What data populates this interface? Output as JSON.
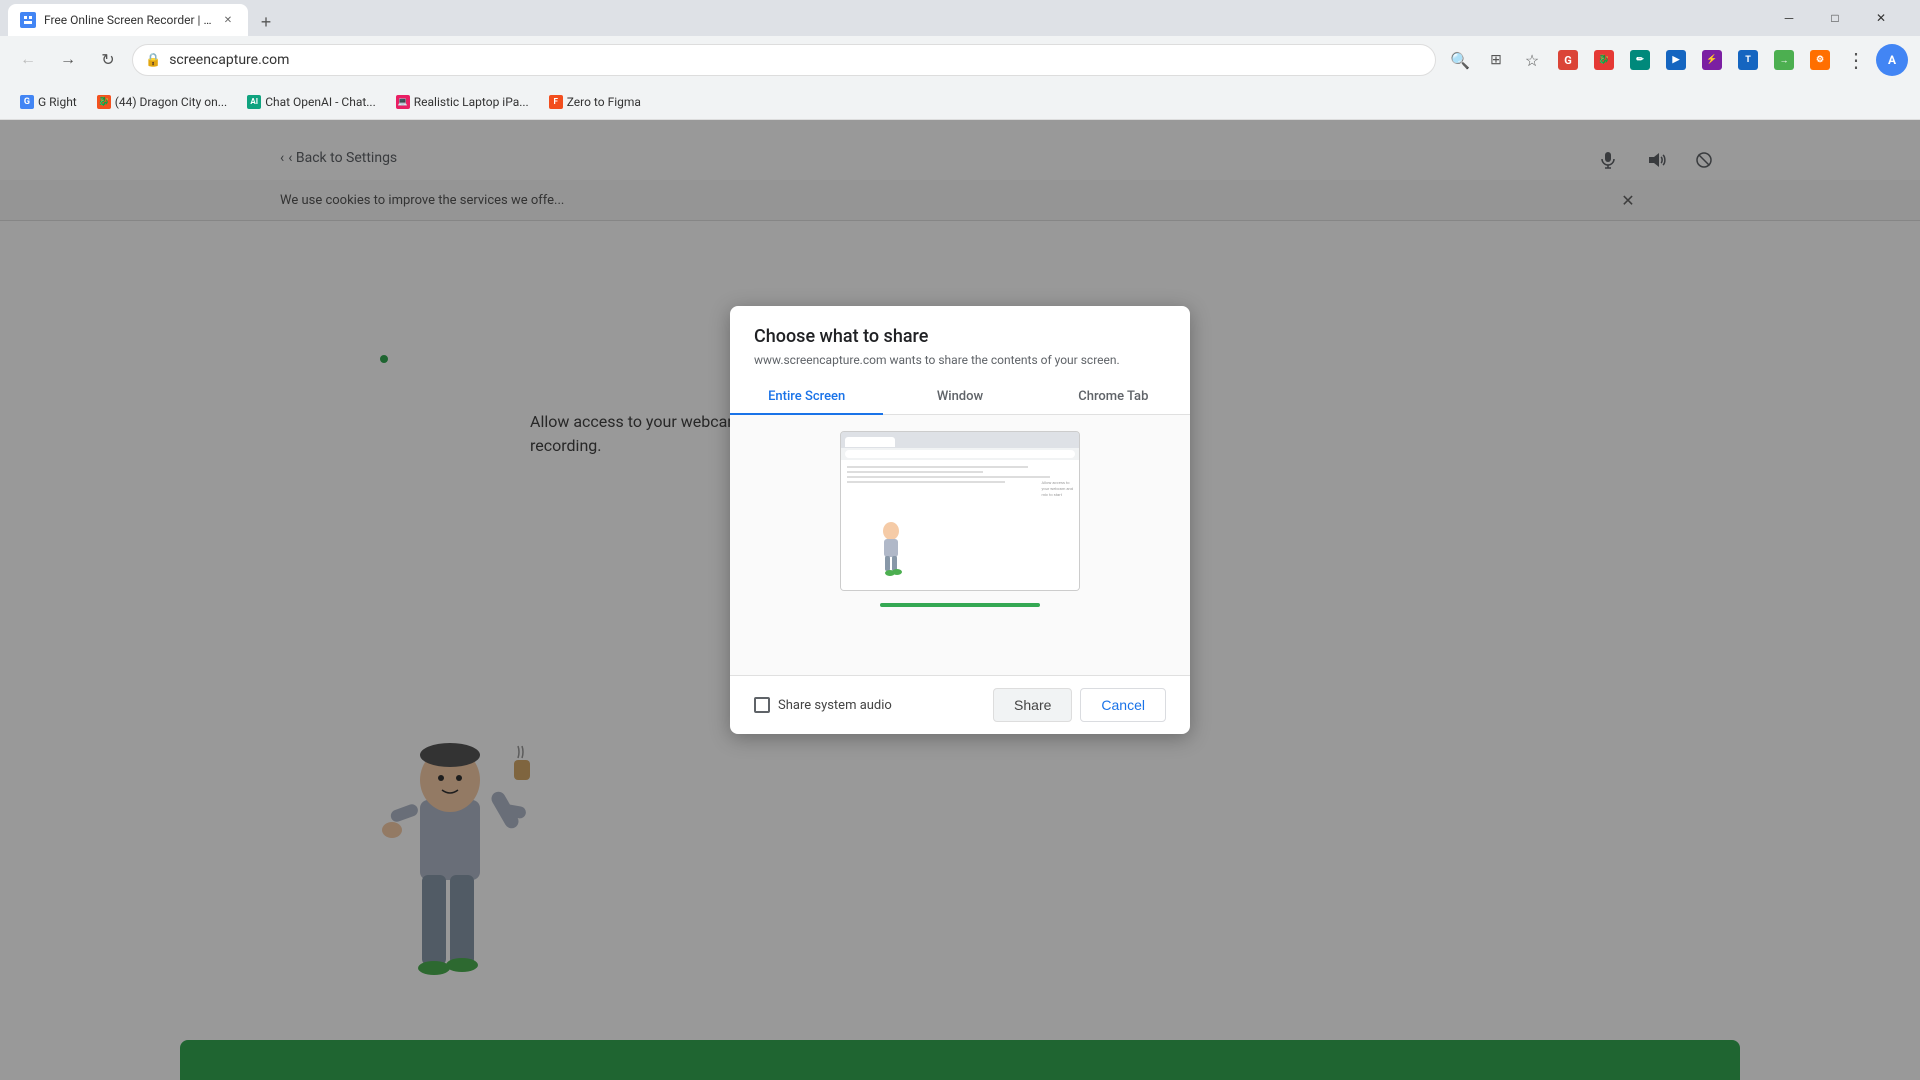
{
  "browser": {
    "tab_title": "Free Online Screen Recorder | O...",
    "url": "screencapture.com",
    "new_tab_label": "+",
    "back_btn": "←",
    "forward_btn": "→",
    "refresh_btn": "↻"
  },
  "bookmarks": [
    {
      "id": "g-right",
      "label": "G Right",
      "color": "#4285f4"
    },
    {
      "id": "dragon-city",
      "label": "(44) Dragon City on...",
      "color": "#f4511e"
    },
    {
      "id": "chat-openai",
      "label": "Chat OpenAI - Chat...",
      "color": "#10a37f"
    },
    {
      "id": "realistic-laptop",
      "label": "Realistic Laptop iPa...",
      "color": "#e91e63"
    },
    {
      "id": "zero-to-figma",
      "label": "Zero to Figma",
      "color": "#f24e1e"
    }
  ],
  "page": {
    "back_link": "‹ Back to Settings",
    "cookie_text": "We use cookies to improve the services we offe...",
    "permission_text": "Allow access to your webcam and mic to start screen recording.",
    "green_dot_visible": true
  },
  "modal": {
    "title": "Choose what to share",
    "subtitle": "www.screencapture.com wants to share the contents of your screen.",
    "tabs": [
      {
        "id": "entire-screen",
        "label": "Entire Screen",
        "active": true
      },
      {
        "id": "window",
        "label": "Window",
        "active": false
      },
      {
        "id": "chrome-tab",
        "label": "Chrome Tab",
        "active": false
      }
    ],
    "share_system_audio_label": "Share system audio",
    "share_audio_checked": false,
    "share_button_label": "Share",
    "cancel_button_label": "Cancel"
  },
  "icons": {
    "mic": "🎤",
    "volume": "🔊",
    "ban": "🚫",
    "search": "🔍",
    "star": "★",
    "menu": "⋮",
    "lock": "🔒",
    "close": "✕",
    "back": "←",
    "forward": "→",
    "refresh": "↻",
    "chevron_left": "‹",
    "profile": "👤"
  }
}
